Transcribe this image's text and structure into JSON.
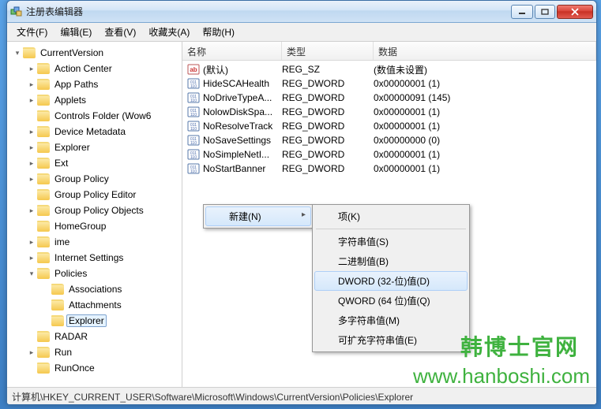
{
  "window": {
    "title": "注册表编辑器"
  },
  "menu": {
    "file": "文件(F)",
    "edit": "编辑(E)",
    "view": "查看(V)",
    "fav": "收藏夹(A)",
    "help": "帮助(H)"
  },
  "tree": [
    {
      "depth": 0,
      "expand": "▾",
      "label": "CurrentVersion"
    },
    {
      "depth": 1,
      "expand": "▸",
      "label": "Action Center"
    },
    {
      "depth": 1,
      "expand": "▸",
      "label": "App Paths"
    },
    {
      "depth": 1,
      "expand": "▸",
      "label": "Applets"
    },
    {
      "depth": 1,
      "expand": " ",
      "label": "Controls Folder (Wow6"
    },
    {
      "depth": 1,
      "expand": "▸",
      "label": "Device Metadata"
    },
    {
      "depth": 1,
      "expand": "▸",
      "label": "Explorer"
    },
    {
      "depth": 1,
      "expand": "▸",
      "label": "Ext"
    },
    {
      "depth": 1,
      "expand": "▸",
      "label": "Group Policy"
    },
    {
      "depth": 1,
      "expand": " ",
      "label": "Group Policy Editor"
    },
    {
      "depth": 1,
      "expand": "▸",
      "label": "Group Policy Objects"
    },
    {
      "depth": 1,
      "expand": " ",
      "label": "HomeGroup"
    },
    {
      "depth": 1,
      "expand": "▸",
      "label": "ime"
    },
    {
      "depth": 1,
      "expand": "▸",
      "label": "Internet Settings"
    },
    {
      "depth": 1,
      "expand": "▾",
      "label": "Policies"
    },
    {
      "depth": 2,
      "expand": " ",
      "label": "Associations"
    },
    {
      "depth": 2,
      "expand": " ",
      "label": "Attachments"
    },
    {
      "depth": 2,
      "expand": " ",
      "label": "Explorer",
      "sel": true
    },
    {
      "depth": 1,
      "expand": " ",
      "label": "RADAR"
    },
    {
      "depth": 1,
      "expand": "▸",
      "label": "Run"
    },
    {
      "depth": 1,
      "expand": " ",
      "label": "RunOnce"
    }
  ],
  "columns": {
    "name": "名称",
    "type": "类型",
    "data": "数据"
  },
  "values": [
    {
      "icon": "sz",
      "name": "(默认)",
      "type": "REG_SZ",
      "data": "(数值未设置)"
    },
    {
      "icon": "dw",
      "name": "HideSCAHealth",
      "type": "REG_DWORD",
      "data": "0x00000001 (1)"
    },
    {
      "icon": "dw",
      "name": "NoDriveTypeA...",
      "type": "REG_DWORD",
      "data": "0x00000091 (145)"
    },
    {
      "icon": "dw",
      "name": "NolowDiskSpa...",
      "type": "REG_DWORD",
      "data": "0x00000001 (1)"
    },
    {
      "icon": "dw",
      "name": "NoResolveTrack",
      "type": "REG_DWORD",
      "data": "0x00000001 (1)"
    },
    {
      "icon": "dw",
      "name": "NoSaveSettings",
      "type": "REG_DWORD",
      "data": "0x00000000 (0)"
    },
    {
      "icon": "dw",
      "name": "NoSimpleNetI...",
      "type": "REG_DWORD",
      "data": "0x00000001 (1)"
    },
    {
      "icon": "dw",
      "name": "NoStartBanner",
      "type": "REG_DWORD",
      "data": "0x00000001 (1)"
    }
  ],
  "ctx1": {
    "new": "新建(N)"
  },
  "ctx2": {
    "key": "项(K)",
    "string": "字符串值(S)",
    "binary": "二进制值(B)",
    "dword": "DWORD (32-位)值(D)",
    "qword": "QWORD (64 位)值(Q)",
    "multi": "多字符串值(M)",
    "expand": "可扩充字符串值(E)"
  },
  "status": "计算机\\HKEY_CURRENT_USER\\Software\\Microsoft\\Windows\\CurrentVersion\\Policies\\Explorer",
  "watermark": {
    "line1": "韩博士官网",
    "line2": "www.hanboshi.com"
  }
}
